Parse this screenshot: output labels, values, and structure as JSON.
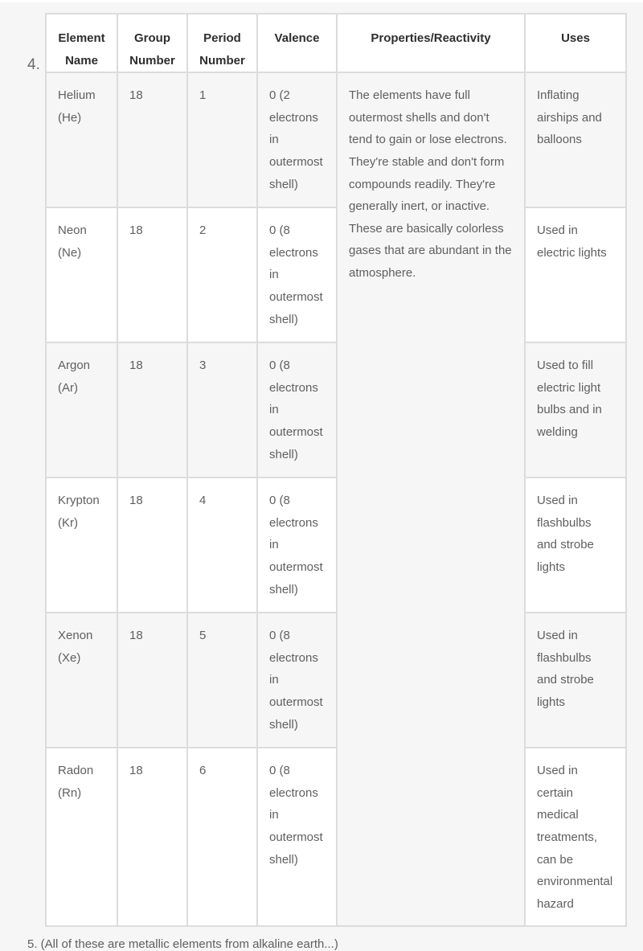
{
  "list_number": "4.",
  "table": {
    "headers": {
      "name": "Element Name",
      "group": "Group Number",
      "period": "Period Number",
      "valence": "Valence",
      "properties": "Properties/Reactivity",
      "uses": "Uses"
    },
    "properties_shared": "The elements have full outermost shells and don't tend to gain or lose electrons. They're stable and don't form compounds readily. They're generally inert, or inactive. These are basically colorless gases that are abundant in the atmosphere.",
    "rows": [
      {
        "name": "Helium (He)",
        "group": "18",
        "period": "1",
        "valence": "0 (2 electrons in outermost shell)",
        "uses": "Inflating airships and balloons"
      },
      {
        "name": "Neon (Ne)",
        "group": "18",
        "period": "2",
        "valence": "0 (8 electrons in outermost shell)",
        "uses": "Used in electric lights"
      },
      {
        "name": "Argon (Ar)",
        "group": "18",
        "period": "3",
        "valence": "0 (8 electrons in outermost shell)",
        "uses": "Used to fill electric light bulbs and in welding"
      },
      {
        "name": "Krypton (Kr)",
        "group": "18",
        "period": "4",
        "valence": "0 (8 electrons in outermost shell)",
        "uses": "Used in flashbulbs and strobe lights"
      },
      {
        "name": "Xenon (Xe)",
        "group": "18",
        "period": "5",
        "valence": "0 (8 electrons in outermost shell)",
        "uses": "Used in flashbulbs and strobe lights"
      },
      {
        "name": "Radon (Rn)",
        "group": "18",
        "period": "6",
        "valence": "0 (8 electrons in outermost shell)",
        "uses": "Used in certain medical treatments, can be environmental hazard"
      }
    ]
  },
  "footer_text": "5. (All of these are metallic elements from alkaline earth...)"
}
